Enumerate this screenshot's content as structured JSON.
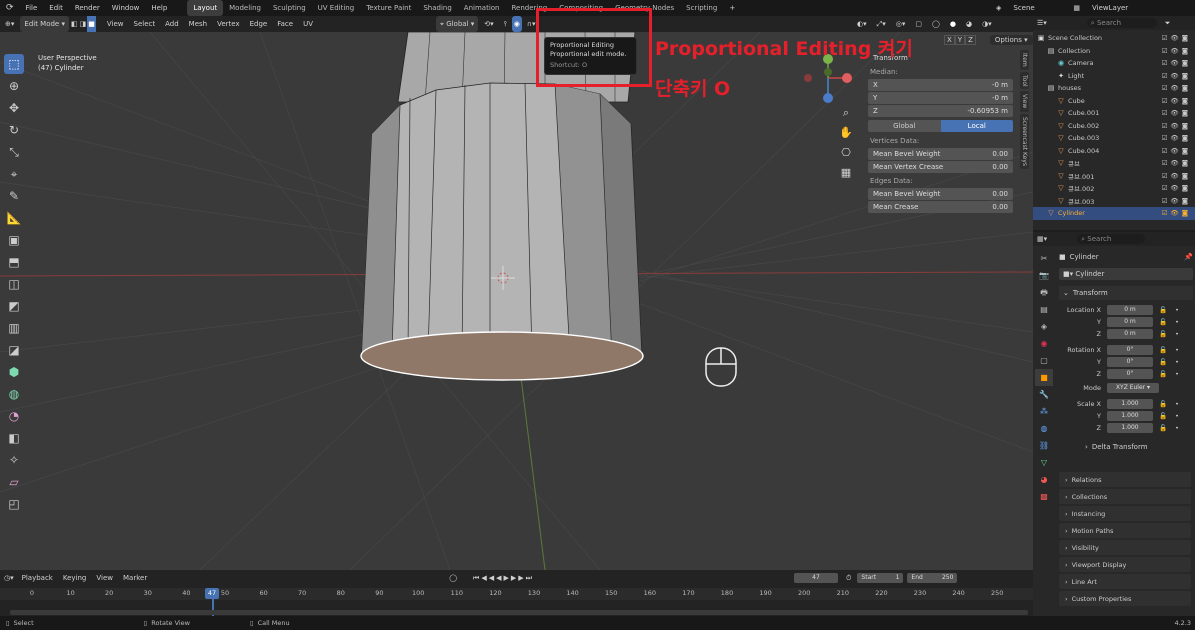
{
  "menu": [
    "File",
    "Edit",
    "Render",
    "Window",
    "Help"
  ],
  "workspaces": [
    "Layout",
    "Modeling",
    "Sculpting",
    "UV Editing",
    "Texture Paint",
    "Shading",
    "Animation",
    "Rendering",
    "Compositing",
    "Geometry Nodes",
    "Scripting"
  ],
  "active_workspace": "Layout",
  "scene": "Scene",
  "view_layer": "ViewLayer",
  "header": {
    "mode": "Edit Mode",
    "menus": [
      "View",
      "Select",
      "Add",
      "Mesh",
      "Vertex",
      "Edge",
      "Face",
      "UV"
    ],
    "orientation": "Global",
    "options": "Options",
    "xyz": [
      "X",
      "Y",
      "Z"
    ]
  },
  "viewport": {
    "perspective": "User Perspective",
    "object_info": "(47) Cylinder",
    "bg_color": "#3a3a3a"
  },
  "tooltip": {
    "title": "Proportional Editing",
    "desc": "Proportional edit mode.",
    "shortcut": "Shortcut: O"
  },
  "annotation": {
    "line1": "Proportional Editing 켜기",
    "line2": "단축키 O",
    "color": "#e5202a"
  },
  "npanel": {
    "title": "Transform",
    "median": "Median:",
    "fields": [
      {
        "label": "X",
        "value": "-0 m"
      },
      {
        "label": "Y",
        "value": "-0 m"
      },
      {
        "label": "Z",
        "value": "-0.60953 m"
      }
    ],
    "global": "Global",
    "local": "Local",
    "vertices_data": "Vertices Data:",
    "vfields": [
      {
        "label": "Mean Bevel Weight",
        "value": "0.00"
      },
      {
        "label": "Mean Vertex Crease",
        "value": "0.00"
      }
    ],
    "edges_data": "Edges Data:",
    "efields": [
      {
        "label": "Mean Bevel Weight",
        "value": "0.00"
      },
      {
        "label": "Mean Crease",
        "value": "0.00"
      }
    ]
  },
  "side_tabs": [
    "Item",
    "Tool",
    "View",
    "Screencast Keys"
  ],
  "outliner": {
    "search": "Search",
    "items": [
      {
        "name": "Scene Collection",
        "indent": 0,
        "icon": "scene-collection-icon",
        "glyph": "▣"
      },
      {
        "name": "Collection",
        "indent": 1,
        "icon": "collection-icon",
        "glyph": "▤"
      },
      {
        "name": "Camera",
        "indent": 2,
        "icon": "camera-icon",
        "glyph": "◉"
      },
      {
        "name": "Light",
        "indent": 2,
        "icon": "light-icon",
        "glyph": "✦"
      },
      {
        "name": "houses",
        "indent": 1,
        "icon": "collection-icon",
        "glyph": "▤"
      },
      {
        "name": "Cube",
        "indent": 2,
        "icon": "mesh-icon",
        "glyph": "▽"
      },
      {
        "name": "Cube.001",
        "indent": 2,
        "icon": "mesh-icon",
        "glyph": "▽"
      },
      {
        "name": "Cube.002",
        "indent": 2,
        "icon": "mesh-icon",
        "glyph": "▽"
      },
      {
        "name": "Cube.003",
        "indent": 2,
        "icon": "mesh-icon",
        "glyph": "▽"
      },
      {
        "name": "Cube.004",
        "indent": 2,
        "icon": "mesh-icon",
        "glyph": "▽"
      },
      {
        "name": "큐브",
        "indent": 2,
        "icon": "mesh-icon",
        "glyph": "▽"
      },
      {
        "name": "큐브.001",
        "indent": 2,
        "icon": "mesh-icon",
        "glyph": "▽"
      },
      {
        "name": "큐브.002",
        "indent": 2,
        "icon": "mesh-icon",
        "glyph": "▽"
      },
      {
        "name": "큐브.003",
        "indent": 2,
        "icon": "mesh-icon",
        "glyph": "▽"
      },
      {
        "name": "Cylinder",
        "indent": 1,
        "icon": "mesh-icon",
        "glyph": "▽",
        "selected": true
      }
    ]
  },
  "properties": {
    "search": "Search",
    "object_name": "Cylinder",
    "object_field": "Cylinder",
    "transform": "Transform",
    "location": [
      {
        "label": "Location X",
        "value": "0 m"
      },
      {
        "label": "Y",
        "value": "0 m"
      },
      {
        "label": "Z",
        "value": "0 m"
      }
    ],
    "rotation": [
      {
        "label": "Rotation X",
        "value": "0°"
      },
      {
        "label": "Y",
        "value": "0°"
      },
      {
        "label": "Z",
        "value": "0°"
      }
    ],
    "mode_label": "Mode",
    "mode_value": "XYZ Euler",
    "scale": [
      {
        "label": "Scale X",
        "value": "1.000"
      },
      {
        "label": "Y",
        "value": "1.000"
      },
      {
        "label": "Z",
        "value": "1.000"
      }
    ],
    "delta": "Delta Transform",
    "sections": [
      "Relations",
      "Collections",
      "Instancing",
      "Motion Paths",
      "Visibility",
      "Viewport Display",
      "Line Art",
      "Custom Properties"
    ]
  },
  "timeline": {
    "menus": [
      "Playback",
      "Keying",
      "View",
      "Marker"
    ],
    "current_frame": "47",
    "start_label": "Start",
    "start": "1",
    "end_label": "End",
    "end": "250",
    "ticks": [
      "0",
      "10",
      "20",
      "30",
      "40",
      "50",
      "60",
      "70",
      "80",
      "90",
      "100",
      "110",
      "120",
      "130",
      "140",
      "150",
      "160",
      "170",
      "180",
      "190",
      "200",
      "210",
      "220",
      "230",
      "240",
      "250"
    ]
  },
  "status": {
    "select": "Select",
    "rotate": "Rotate View",
    "call_menu": "Call Menu",
    "version": "4.2.3"
  }
}
